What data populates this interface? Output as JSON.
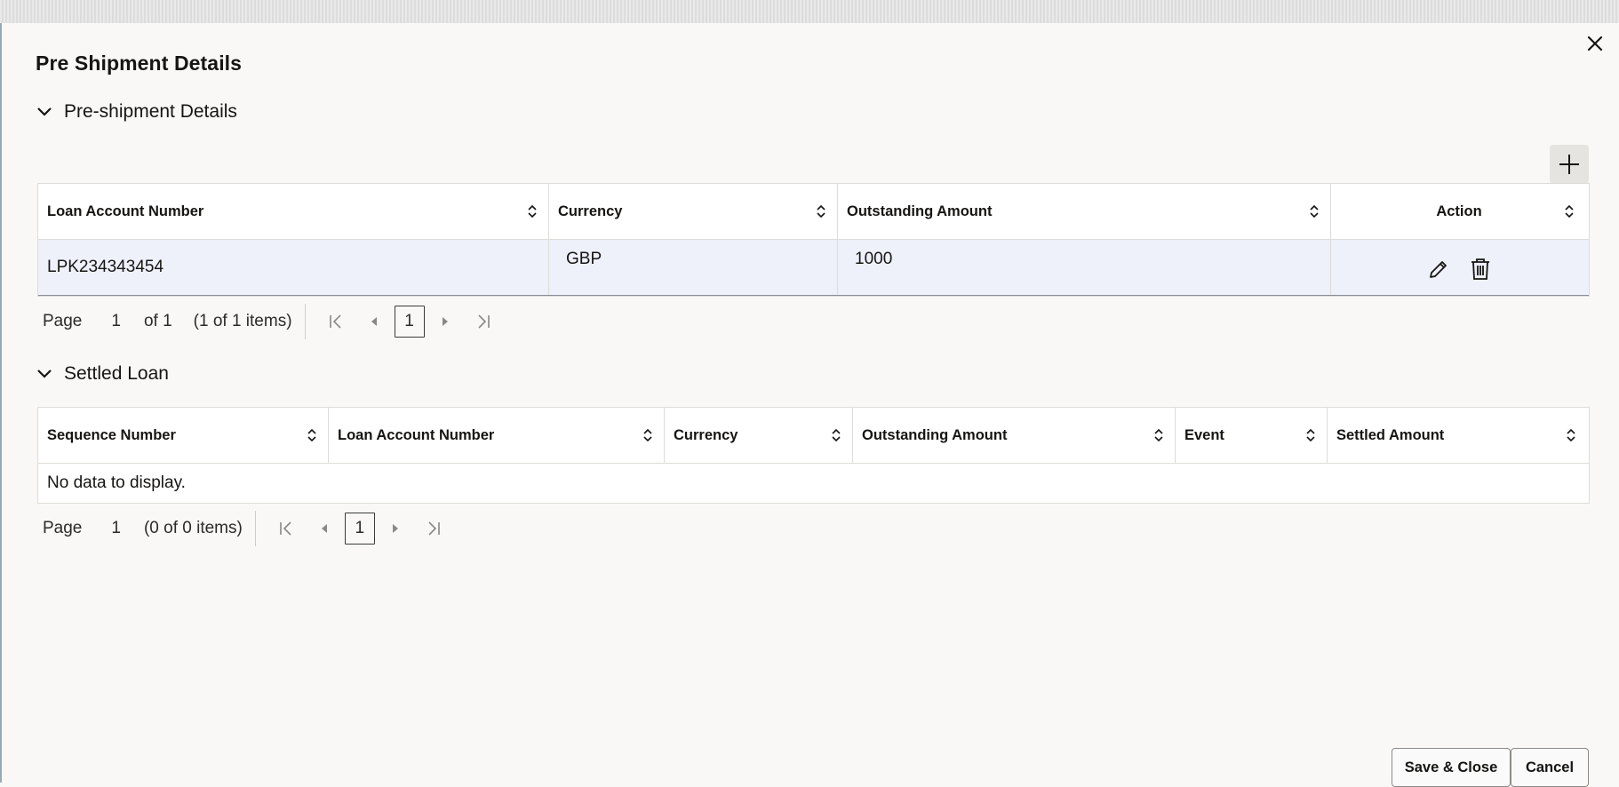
{
  "dialog": {
    "title": "Pre Shipment Details"
  },
  "preshipment": {
    "section_title": "Pre-shipment Details",
    "columns": [
      "Loan Account Number",
      "Currency",
      "Outstanding Amount",
      "Action"
    ],
    "rows": [
      {
        "loan_account_number": "LPK234343454",
        "currency": "GBP",
        "outstanding_amount": "1000"
      }
    ],
    "pager": {
      "page_label": "Page",
      "page_input": "1",
      "of_text": "of 1",
      "items_text": "(1 of 1 items)",
      "current_page": "1"
    }
  },
  "settled": {
    "section_title": "Settled Loan",
    "columns": [
      "Sequence Number",
      "Loan Account Number",
      "Currency",
      "Outstanding Amount",
      "Event",
      "Settled Amount"
    ],
    "empty_text": "No data to display.",
    "pager": {
      "page_label": "Page",
      "page_input": "1",
      "items_text": "(0 of 0 items)",
      "current_page": "1"
    }
  },
  "footer": {
    "save_close_label": "Save & Close",
    "cancel_label": "Cancel"
  },
  "icons": {
    "close": "close-icon",
    "collapse": "chevron-down-icon",
    "add": "plus-icon",
    "sort": "sort-icon",
    "edit": "pencil-icon",
    "delete": "trash-icon",
    "first": "first-page-icon",
    "prev": "previous-page-icon",
    "next": "next-page-icon",
    "last": "last-page-icon"
  }
}
